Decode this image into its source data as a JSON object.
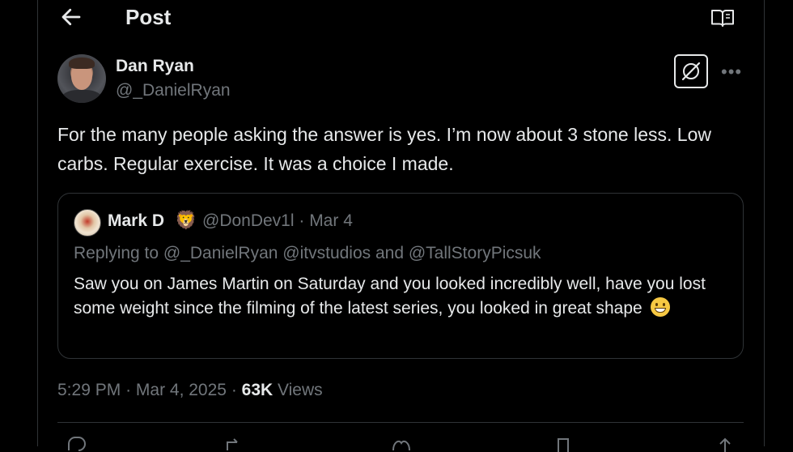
{
  "header": {
    "title": "Post"
  },
  "post": {
    "author_name": "Dan Ryan",
    "author_handle": "@_DanielRyan",
    "text": "For the many people asking the answer is yes. I’m now about 3 stone less. Low carbs. Regular exercise. It was a choice I made.",
    "time": "5:29 PM",
    "date": "Mar 4, 2025",
    "views_count": "63K",
    "views_label": "Views"
  },
  "quote": {
    "author_name": "Mark D",
    "author_emoji": "🦁",
    "author_handle": "@DonDev1l · Mar 4",
    "replying_to": "Replying to @_DanielRyan @itvstudios and @TallStoryPicsuk",
    "text": "Saw you on James Martin on Saturday and you looked incredibly well, have you lost some weight since the filming of the latest series, you looked in great shape"
  },
  "icons": {
    "back": "arrow-left-icon",
    "reader": "open-book-icon",
    "grok": "grok-slash-icon",
    "more": "more-dots-icon",
    "emoji": "grinning-face-icon"
  },
  "colors": {
    "background": "#000000",
    "text": "#e7e9ea",
    "muted": "#71767b",
    "border": "#2f3336"
  }
}
